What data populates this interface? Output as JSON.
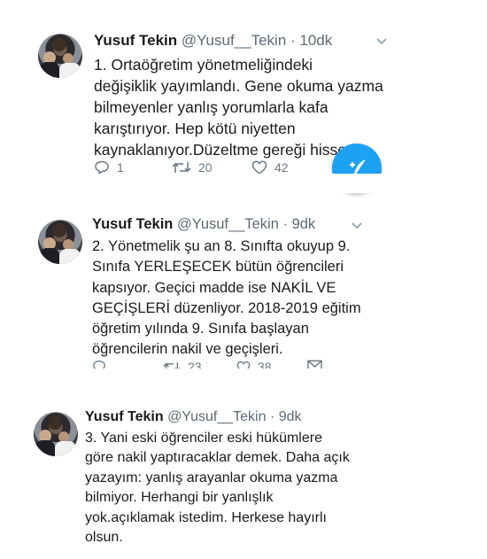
{
  "tweets": [
    {
      "name": "Yusuf Tekin",
      "handle": "@Yusuf__Tekin",
      "time": "· 10dk",
      "lines": [
        "1. Ortaöğretim yönetmeliğindeki",
        "değişiklik yayımlandı. Gene okuma yazma",
        "bilmeyenler yanlış yorumlarla kafa",
        "karıştırıyor. Hep kötü niyetten",
        "kaynaklanıyor.Düzeltme gereği hissettim."
      ],
      "replies": "1",
      "retweets": "20",
      "likes": "42"
    },
    {
      "name": "Yusuf Tekin",
      "handle": "@Yusuf__Tekin",
      "time": "· 9dk",
      "lines": [
        "2. Yönetmelik şu an 8. Sınıfta okuyup 9.",
        "Sınıfa YERLEŞECEK bütün öğrencileri",
        "kapsıyor. Geçici madde ise NAKİL VE",
        "GEÇİŞLERİ düzenliyor. 2018-2019 eğitim",
        "öğretim yılında 9. Sınıfa başlayan",
        "öğrencilerin nakil ve geçişleri."
      ],
      "replies": "",
      "retweets": "23",
      "likes": "38"
    },
    {
      "name": "Yusuf Tekin",
      "handle": "@Yusuf__Tekin",
      "time": "· 9dk",
      "lines": [
        "3. Yani eski öğrenciler eski hükümlere",
        "göre nakil yaptıracaklar demek. Daha açık",
        "yazayım: yanlış arayanlar okuma yazma",
        "bilmiyor. Herhangi bir yanlışlık",
        "yok.açıklamak istedim. Herkese hayırlı",
        "olsun."
      ]
    }
  ],
  "icons": {
    "reply": "reply-icon",
    "retweet": "retweet-icon",
    "like": "heart-icon",
    "share": "share-icon",
    "compose": "compose-tweet-icon",
    "more": "chevron-down-icon"
  },
  "colors": {
    "accent": "#1da1f2",
    "name": "#1b1b1b",
    "meta": "#5d6a75"
  }
}
